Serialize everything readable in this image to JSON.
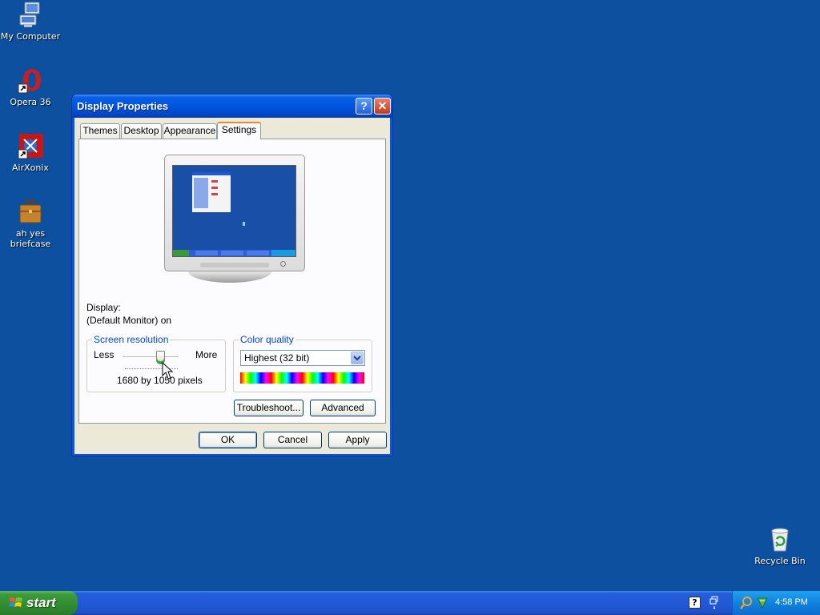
{
  "desktop": {
    "icons": [
      {
        "label": "My Computer"
      },
      {
        "label": "Opera 36"
      },
      {
        "label": "AirXonix"
      },
      {
        "label": "ah yes briefcase"
      },
      {
        "label": "Recycle Bin"
      }
    ]
  },
  "dialog": {
    "title": "Display Properties",
    "help_label": "?",
    "close_label": "✕",
    "tabs": [
      {
        "label": "Themes"
      },
      {
        "label": "Desktop"
      },
      {
        "label": "Appearance"
      },
      {
        "label": "Settings",
        "active": true
      }
    ],
    "display_label": "Display:",
    "display_value": "(Default Monitor) on",
    "resolution": {
      "title": "Screen resolution",
      "less_label": "Less",
      "more_label": "More",
      "value_text": "1680 by 1050 pixels",
      "slider_fraction": 0.68
    },
    "color_quality": {
      "title": "Color quality",
      "selected": "Highest (32 bit)"
    },
    "buttons": {
      "troubleshoot": "Troubleshoot...",
      "advanced": "Advanced",
      "ok": "OK",
      "cancel": "Cancel",
      "apply": "Apply"
    }
  },
  "taskbar": {
    "start_label": "start",
    "clock": "4:58 PM"
  },
  "colors": {
    "desktop_bg": "#0c509f",
    "title_blue": "#0055e0",
    "start_green": "#3c9a3c",
    "group_title_blue": "#0046d5"
  },
  "icons": {
    "help": "help-icon",
    "close": "close-icon",
    "dropdown": "chevron-down-icon",
    "windows_logo": "windows-logo-icon"
  }
}
